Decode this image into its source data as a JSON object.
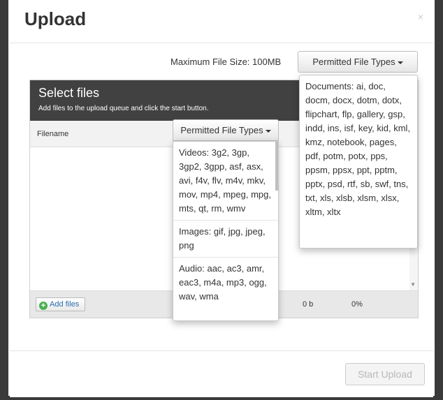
{
  "modal": {
    "title": "Upload",
    "close_label": "×"
  },
  "toolbar": {
    "max_file_size": "Maximum File Size: 100MB",
    "permitted_types_label": "Permitted File Types"
  },
  "uploader": {
    "title": "Select files",
    "subtitle": "Add files to the upload queue and click the start button.",
    "column_filename": "Filename",
    "add_files_label": "Add files",
    "total_size": "0 b",
    "total_percent": "0%"
  },
  "footer": {
    "start_upload_label": "Start Upload"
  },
  "permitted_dropdown_docs": {
    "documents": "Documents: ai, doc, docm, docx, dotm, dotx, flipchart, flp, gallery, gsp, indd, ins, isf, key, kid, kml, kmz, notebook, pages, pdf, potm, potx, pps, ppsm, ppsx, ppt, pptm, pptx, psd, rtf, sb, swf, tns, txt, xls, xlsb, xlsm, xlsx, xltm, xltx"
  },
  "permitted_dropdown_media": {
    "label": "Permitted File Types",
    "videos": "Videos: 3g2, 3gp, 3gp2, 3gpp, asf, asx, avi, f4v, flv, m4v, mkv, mov, mp4, mpeg, mpg, mts, qt, rm, wmv",
    "images": "Images: gif, jpg, jpeg, png",
    "audio": "Audio: aac, ac3, amr, eac3, m4a, mp3, ogg, wav, wma"
  },
  "colors": {
    "header_dark": "#414141",
    "add_icon_green": "#4caf50",
    "link_blue": "#2a6fb1"
  }
}
